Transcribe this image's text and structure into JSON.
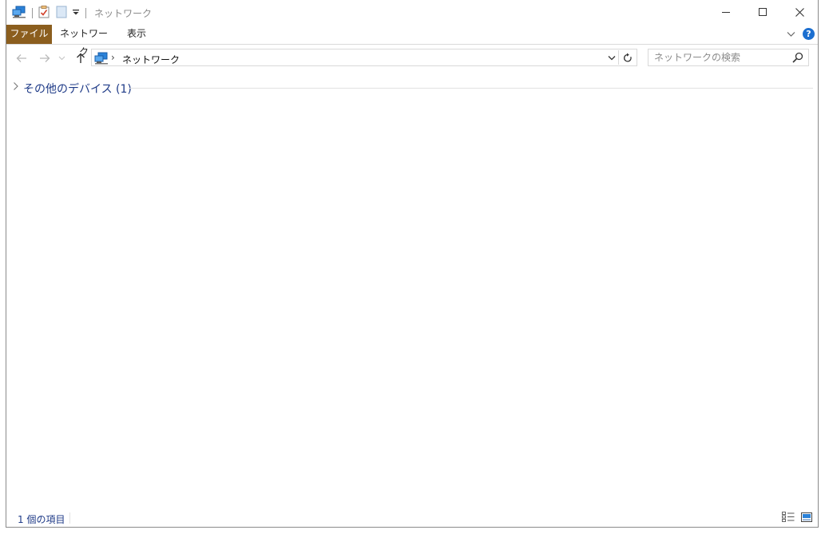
{
  "window": {
    "title": "ネットワーク",
    "controls": {
      "minimize": "minimize-icon",
      "maximize": "maximize-icon",
      "close": "close-icon"
    }
  },
  "quick_access": {
    "icons": [
      "network-icon",
      "properties-icon",
      "new-folder-icon",
      "customize-dropdown-icon"
    ]
  },
  "ribbon": {
    "tabs": [
      {
        "label": "ファイル",
        "active": true
      },
      {
        "label": "ネットワーク",
        "active": false
      },
      {
        "label": "表示",
        "active": false
      }
    ],
    "accent_color": "#8b5e1e",
    "help_label": "?"
  },
  "address": {
    "path": "ネットワーク",
    "separator": "›"
  },
  "search": {
    "placeholder": "ネットワークの検索",
    "value": ""
  },
  "content": {
    "groups": [
      {
        "label": "その他のデバイス (1)",
        "collapsed": true
      }
    ]
  },
  "status": {
    "item_count": "1 個の項目"
  }
}
